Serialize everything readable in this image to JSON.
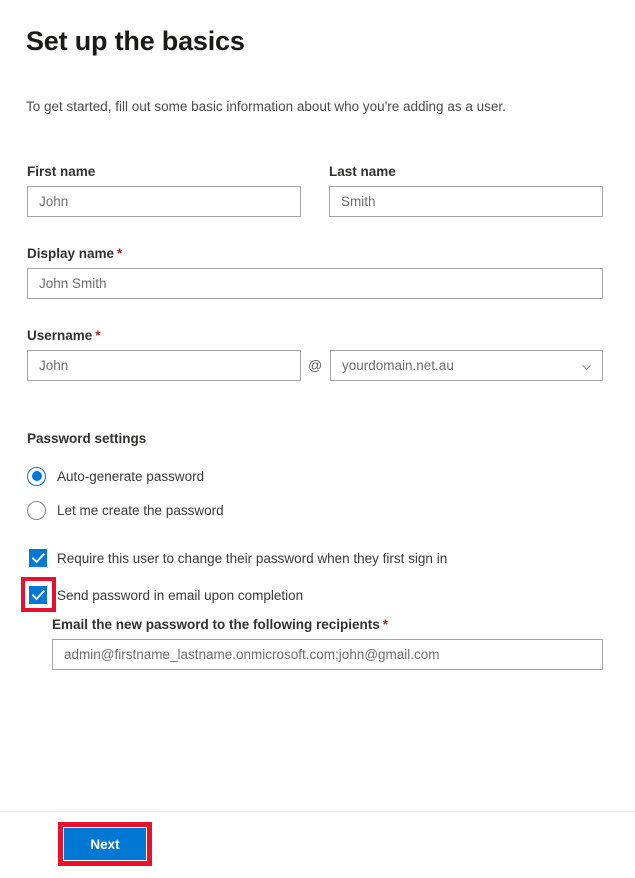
{
  "header": {
    "title": "Set up the basics",
    "subtitle": "To get started, fill out some basic information about who you're adding as a user."
  },
  "form": {
    "first_name": {
      "label": "First name",
      "value": "John",
      "required": false
    },
    "last_name": {
      "label": "Last name",
      "value": "Smith",
      "required": false
    },
    "display_name": {
      "label": "Display name",
      "value": "John Smith",
      "required": true,
      "required_marker": "*"
    },
    "username": {
      "label": "Username",
      "value": "John",
      "required": true,
      "required_marker": "*",
      "at_symbol": "@",
      "domain_value": "yourdomain.net.au",
      "domain_icon": "chevron-down-icon"
    }
  },
  "password_settings": {
    "heading": "Password settings",
    "options": [
      {
        "label": "Auto-generate password",
        "selected": true
      },
      {
        "label": "Let me create the password",
        "selected": false
      }
    ],
    "checkboxes": [
      {
        "label": "Require this user to change their password when they first sign in",
        "checked": true,
        "highlighted": false
      },
      {
        "label": "Send password in email upon completion",
        "checked": true,
        "highlighted": true
      }
    ],
    "recipients": {
      "label": "Email the new password to the following recipients",
      "required": true,
      "required_marker": "*",
      "value": "admin@firstname_lastname.onmicrosoft.com;john@gmail.com"
    }
  },
  "footer": {
    "next_label": "Next"
  },
  "colors": {
    "accent": "#0078d4",
    "required_star": "#a4262c",
    "highlight": "#e8112d",
    "field_border": "#a6a6a6",
    "text": "#323130",
    "muted_text": "#6e6e6e"
  }
}
